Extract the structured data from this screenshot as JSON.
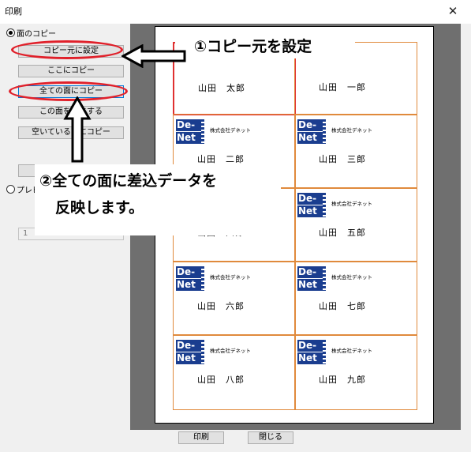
{
  "window": {
    "title": "印刷",
    "close_glyph": "✕"
  },
  "left_panel": {
    "copy_section_label": "面のコピー",
    "buttons": {
      "set_copy_source": "コピー元に設定",
      "copy_here": "ここにコピー",
      "copy_to_all": "全ての面にコピー",
      "make_empty": "この面を空にする",
      "copy_to_empty": "空いている面にコピー",
      "blank_button": ""
    },
    "preview_label": "プレビ",
    "page_value": "1"
  },
  "preview": {
    "company_name": "株式会社デネット",
    "logo": {
      "line1": "De-",
      "line2": "Net"
    },
    "names": [
      "山田　太郎",
      "山田　一郎",
      "山田　二郎",
      "山田　三郎",
      "山田　四郎",
      "山田　五郎",
      "山田　六郎",
      "山田　七郎",
      "山田　八郎",
      "山田　九郎"
    ]
  },
  "callouts": {
    "top": "①コピー元を設定",
    "bottom_line1": "②全ての面に差込データを",
    "bottom_line2": "反映します。"
  },
  "bottom": {
    "print_button": "印刷",
    "close_button": "閉じる"
  },
  "colors": {
    "annotation_red": "#e0202a",
    "logo_blue": "#1a3d8f",
    "label_border": "#e08a3c"
  }
}
